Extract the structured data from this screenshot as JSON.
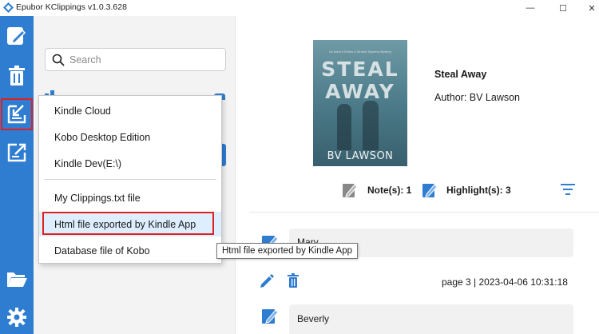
{
  "window": {
    "title": "Epubor KClippings v1.0.3.628",
    "minimize_glyph": "—",
    "maximize_glyph": "☐",
    "close_glyph": "✕"
  },
  "sidebar": {
    "items": [
      {
        "name": "new-note-icon"
      },
      {
        "name": "trash-icon"
      },
      {
        "name": "import-clippings-icon",
        "selected": true
      },
      {
        "name": "export-icon"
      },
      {
        "name": "folder-icon"
      },
      {
        "name": "settings-icon"
      }
    ]
  },
  "search": {
    "placeholder": "Search"
  },
  "import_menu": {
    "items": [
      {
        "label": "Kindle Cloud"
      },
      {
        "label": "Kobo Desktop Edition"
      },
      {
        "label": "Kindle Dev(E:\\)"
      },
      {
        "label": "My Clippings.txt file"
      },
      {
        "label": "Html file exported by Kindle App",
        "highlighted": true
      },
      {
        "label": "Database file of Kobo"
      }
    ],
    "tooltip": "Html file exported by Kindle App"
  },
  "book": {
    "title": "Steal Away",
    "author": "Author: BV Lawson",
    "cover": {
      "title_line1": "STEAL",
      "title_line2": "AWAY",
      "author": "BV LAWSON",
      "tagline": "An Actor's Series & Murder Mystery Mystery",
      "colors": {
        "top": "#6f9aa6",
        "bottom": "#385f6d"
      }
    }
  },
  "stats": {
    "notes": "Note(s): 1",
    "highlights": "Highlight(s): 3"
  },
  "notes": [
    {
      "text": "Mary ..."
    },
    {
      "text": "Beverly"
    }
  ],
  "note_meta": "page 3 | 2023-04-06 10:31:18",
  "colors": {
    "accent": "#2f7dd0",
    "selection_outline": "#e02020",
    "menu_highlight": "#ddeeff"
  }
}
